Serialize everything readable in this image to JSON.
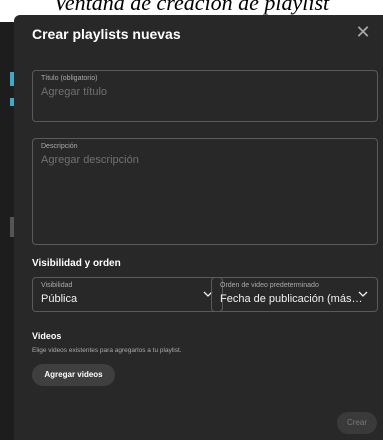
{
  "caption": "Ventana de creación de playlist",
  "dialog": {
    "title": "Crear playlists nuevas",
    "close_glyph": "✕",
    "fields": {
      "title_label": "Título (obligatorio)",
      "title_placeholder": "Agregar título",
      "description_label": "Descripción",
      "description_placeholder": "Agregar descripción"
    },
    "visibility_section": {
      "heading": "Visibilidad y orden",
      "visibility_label": "Visibilidad",
      "visibility_value": "Pública",
      "order_label": "Orden de video predeterminado",
      "order_value": "Fecha de publicación (más…"
    },
    "videos_section": {
      "heading": "Videos",
      "description": "Elige videos existentes para agregarlos a tu playlist.",
      "add_button": "Agregar videos"
    },
    "create_button": "Crear"
  },
  "colors": {
    "dialog_bg": "#282828",
    "accent_backdrop": "#3fa9c6"
  }
}
